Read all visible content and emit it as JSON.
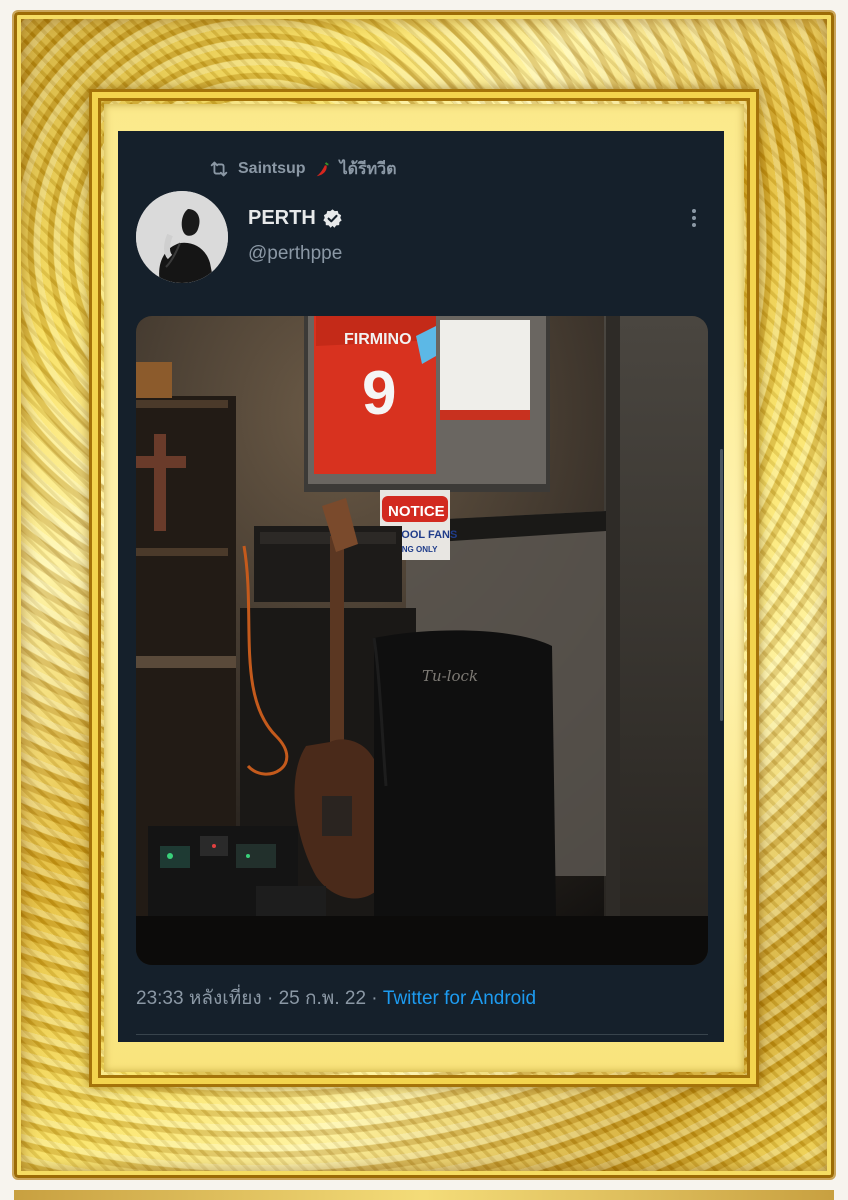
{
  "retweet": {
    "user": "Saintsup",
    "emoji": "🌶",
    "action": "ได้รีทวีต",
    "icon": "retweet-icon"
  },
  "author": {
    "name": "PERTH",
    "handle": "@perthppe",
    "verified": true,
    "avatar_icon": "avatar-photo"
  },
  "tweet": {
    "time": "23:33 หลังเที่ยง",
    "separator": " · ",
    "date": "25 ก.พ. 22",
    "client": "Twitter for Android"
  },
  "photo": {
    "jersey_name": "FIRMINO",
    "jersey_number": "9",
    "sign_title": "NOTICE",
    "sign_line1": "RPOOL FANS",
    "sign_line2": "RKING ONLY",
    "shirt_print": "Tu-lock"
  },
  "colors": {
    "tweet_bg": "#15202b",
    "text_primary": "#e7e9ea",
    "text_secondary": "#8b98a5",
    "link": "#1d9bf0",
    "frame_gold": "#e8c53a"
  }
}
